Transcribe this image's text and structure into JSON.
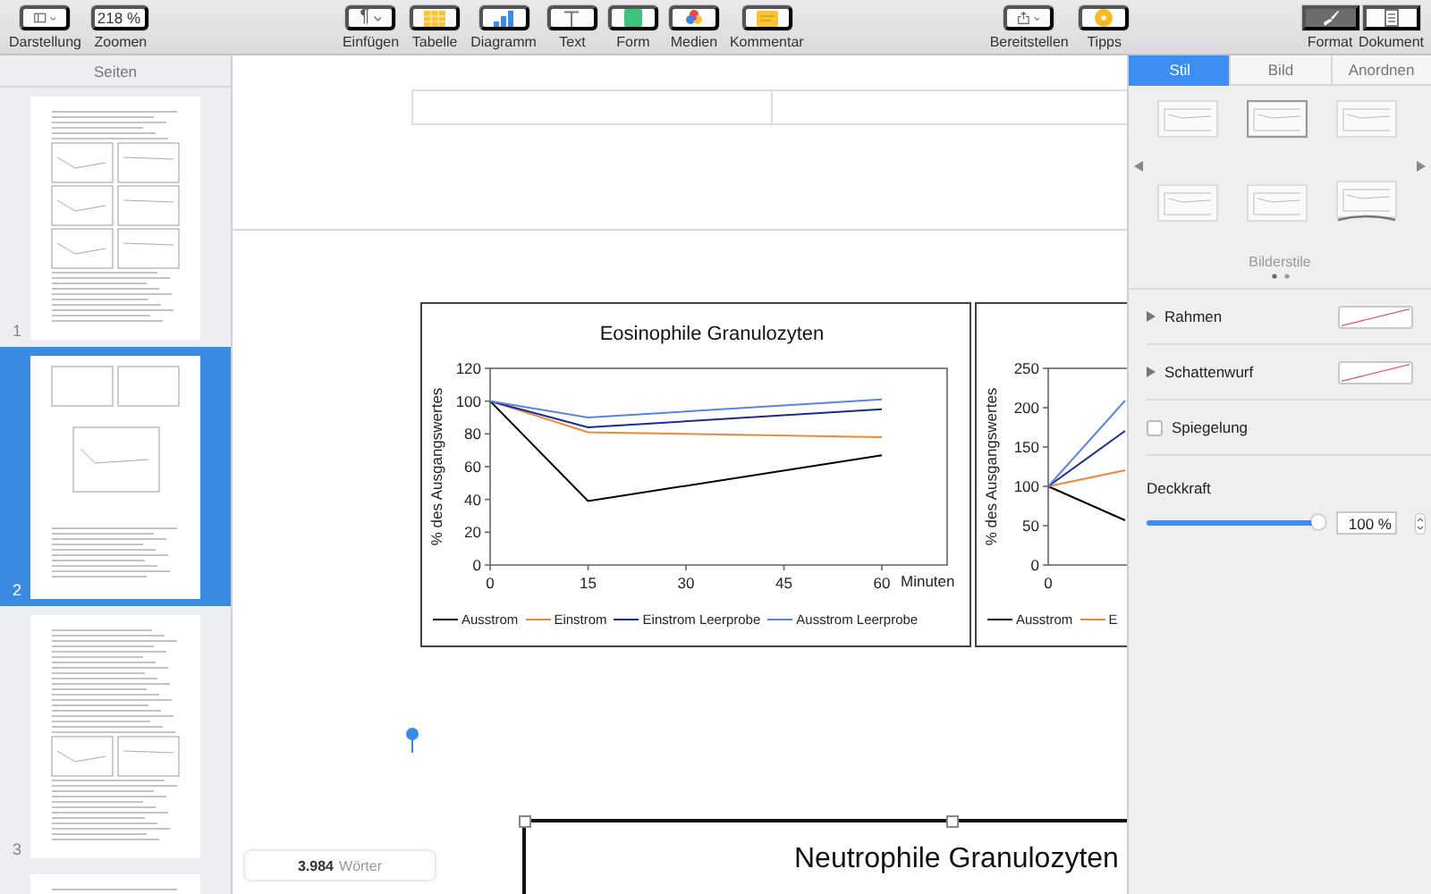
{
  "toolbar": {
    "groups": [
      [
        {
          "kind": "view",
          "label": "Darstellung"
        },
        {
          "kind": "zoom",
          "label": "Zoomen",
          "value": "218 %"
        }
      ],
      [
        {
          "kind": "insert",
          "label": "Einfügen",
          "glyph": "¶"
        },
        {
          "kind": "table",
          "label": "Tabelle"
        },
        {
          "kind": "chart",
          "label": "Diagramm"
        },
        {
          "kind": "text",
          "label": "Text"
        },
        {
          "kind": "shape",
          "label": "Form"
        },
        {
          "kind": "media",
          "label": "Medien"
        },
        {
          "kind": "comment",
          "label": "Kommentar"
        }
      ],
      [
        {
          "kind": "share",
          "label": "Bereitstellen"
        },
        {
          "kind": "tips",
          "label": "Tipps"
        }
      ],
      [
        {
          "kind": "format",
          "label": "Format",
          "selected": true
        },
        {
          "kind": "document",
          "label": "Dokument",
          "selected": false
        }
      ]
    ]
  },
  "sidebar": {
    "title": "Seiten",
    "pages": [
      {
        "number": "1",
        "selected": false
      },
      {
        "number": "2",
        "selected": true
      },
      {
        "number": "3",
        "selected": false
      },
      {
        "selected": false
      }
    ]
  },
  "document": {
    "charts": [
      {
        "chart_data": {
          "type": "line",
          "legend": true,
          "title": "Eosinophile Granulozyten",
          "xlabel": "Minuten",
          "ylabel": "% des Ausgangswertes",
          "x": [
            0,
            15,
            60
          ],
          "xlim": [
            0,
            70
          ],
          "ylim": [
            0,
            120
          ],
          "xticks": [
            0,
            15,
            30,
            45,
            60
          ],
          "yticks": [
            0,
            20,
            40,
            60,
            80,
            100,
            120
          ],
          "series": [
            {
              "name": "Ausstrom",
              "color": "#000000",
              "values": [
                100,
                39,
                67
              ]
            },
            {
              "name": "Einstrom",
              "color": "#f0883a",
              "values": [
                100,
                81,
                78
              ]
            },
            {
              "name": "Einstrom Leerprobe",
              "color": "#1c2c8c",
              "values": [
                100,
                84,
                95
              ]
            },
            {
              "name": "Ausstrom Leerprobe",
              "color": "#5a82e8",
              "values": [
                100,
                90,
                101
              ]
            }
          ]
        }
      },
      {
        "kind": "cropped_plot",
        "ylabel": "% des Ausgangswertes",
        "y_tick_labels": [
          "250",
          "200",
          "150",
          "100",
          "50",
          "0"
        ],
        "x_tick_labels": [
          "0"
        ],
        "legend": [
          {
            "label": "Ausstrom",
            "color": "#000000"
          },
          {
            "label": "E",
            "color": "#f0883a"
          }
        ]
      }
    ],
    "lower_chart": {
      "title": "Neutrophile Granulozyten"
    },
    "word_count": {
      "count": "3.984",
      "unit": "Wörter"
    }
  },
  "inspector": {
    "tabs": [
      {
        "label": "Stil",
        "selected": true
      },
      {
        "label": "Bild",
        "selected": false
      },
      {
        "label": "Anordnen",
        "selected": false
      }
    ],
    "styles_label": "Bilderstile",
    "sections": [
      {
        "kind": "disclosure",
        "label": "Rahmen",
        "expanded": false
      },
      {
        "kind": "disclosure",
        "label": "Schattenwurf",
        "expanded": false
      },
      {
        "kind": "checkbox",
        "label": "Spiegelung",
        "checked": false
      },
      {
        "kind": "slider",
        "label": "Deckkraft",
        "level": 1,
        "value": "100 %"
      }
    ]
  }
}
